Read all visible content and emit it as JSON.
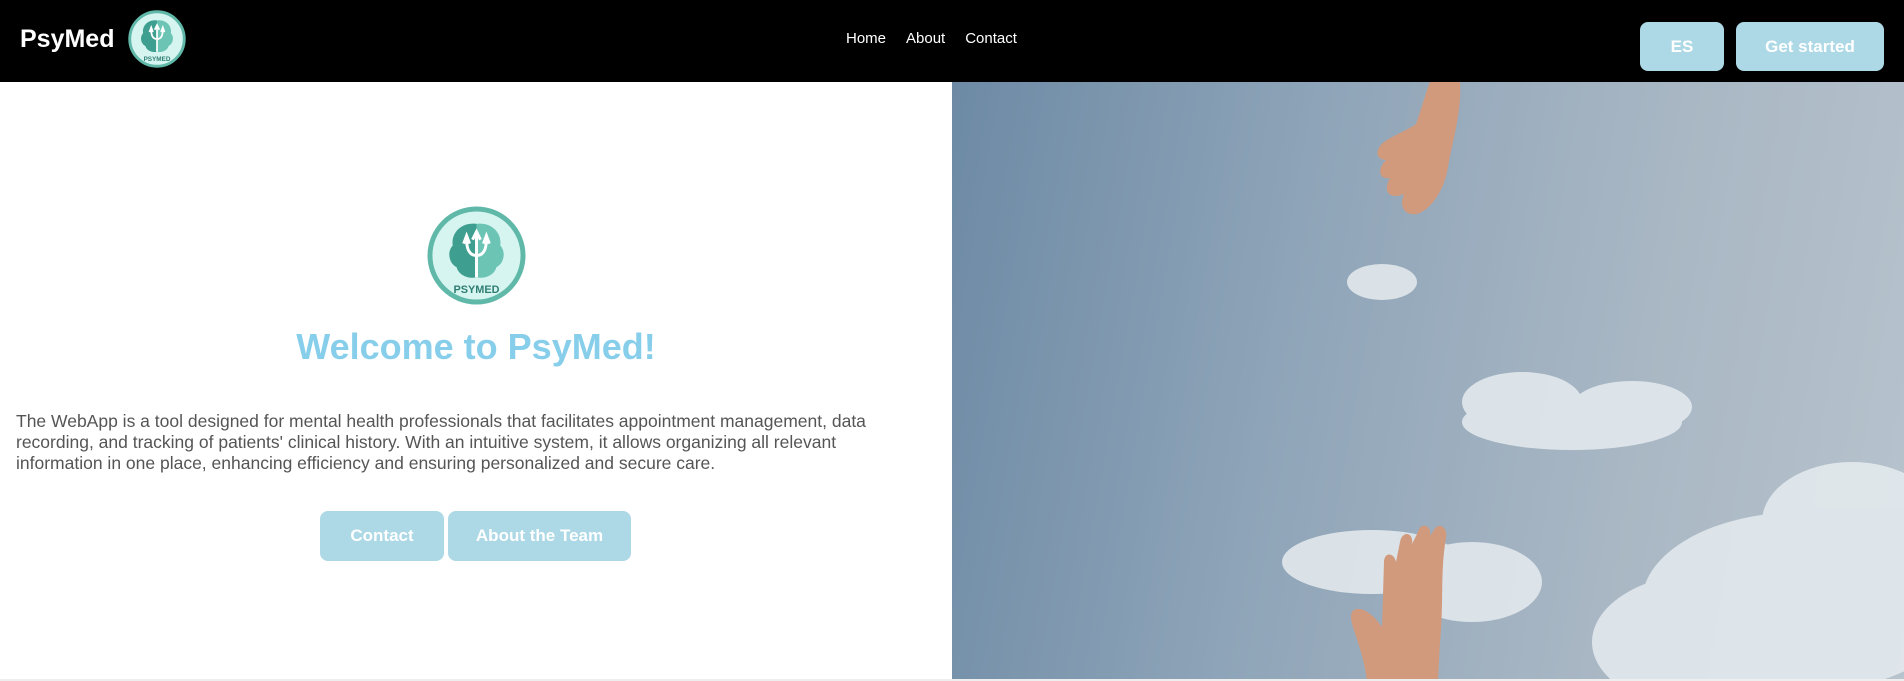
{
  "brand": {
    "name": "PsyMed",
    "logo_text": "PSYMED"
  },
  "nav": {
    "links": [
      "Home",
      "About",
      "Contact"
    ],
    "language_button": "ES",
    "get_started_button": "Get started"
  },
  "hero": {
    "title": "Welcome to PsyMed!",
    "description": "The WebApp is a tool designed for mental health professionals that facilitates appointment management, data recording, and tracking of patients' clinical history. With an intuitive system, it allows organizing all relevant information in one place, enhancing efficiency and ensuring personalized and secure care.",
    "buttons": {
      "contact": "Contact",
      "about_team": "About the Team"
    }
  },
  "colors": {
    "navbar_bg": "#000000",
    "button_bg": "#add8e6",
    "title_color": "#87ceeb",
    "text_color": "#555555",
    "logo_teal": "#5fb8a8"
  },
  "icons": {
    "logo": "brain-psi-logo-icon"
  }
}
